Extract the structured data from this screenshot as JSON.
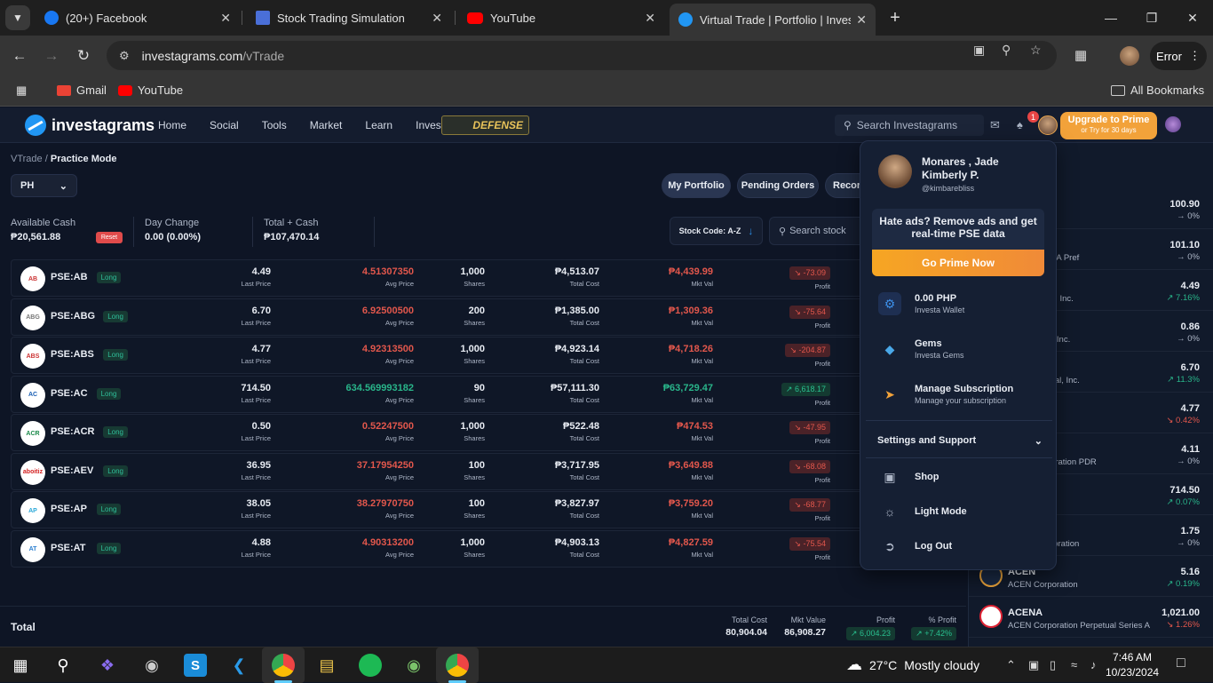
{
  "browser": {
    "tabs": [
      {
        "title": "(20+) Facebook",
        "favicon": "facebook-icon",
        "color": "#1877f2"
      },
      {
        "title": "Stock Trading Simulation",
        "favicon": "chart-icon",
        "color": "#4a6fd8"
      },
      {
        "title": "YouTube",
        "favicon": "youtube-icon",
        "color": "#ff0000"
      },
      {
        "title": "Virtual Trade | Portfolio | Investa",
        "favicon": "investagrams-icon",
        "color": "#2196f3"
      }
    ],
    "url_domain": "investagrams.com",
    "url_path": "/vTrade",
    "error_label": "Error",
    "bookmarks": [
      {
        "label": "Gmail",
        "icon": "gmail-icon"
      },
      {
        "label": "YouTube",
        "icon": "youtube-icon"
      }
    ],
    "all_bookmarks_label": "All Bookmarks"
  },
  "site": {
    "logo_text": "investagrams",
    "nav": [
      "Home",
      "Social",
      "Tools",
      "Market",
      "Learn",
      "Invest"
    ],
    "defense_label": "DEFENSE",
    "search_placeholder": "Search Investagrams",
    "notification_count": "1",
    "upgrade_title": "Upgrade to Prime",
    "upgrade_sub": "or Try for 30 days"
  },
  "portfolio": {
    "breadcrumb_root": "VTrade",
    "breadcrumb_sep": "/",
    "breadcrumb_current": "Practice Mode",
    "country": "PH",
    "tabs": [
      "My Portfolio",
      "Pending Orders",
      "Recor"
    ],
    "available_cash_label": "Available Cash",
    "available_cash": "₱20,561.88",
    "reset_label": "Reset",
    "day_change_label": "Day Change",
    "day_change": "0.00 (0.00%)",
    "total_cash_label": "Total + Cash",
    "total_cash": "₱107,470.14",
    "sort_label": "Stock Code: A-Z",
    "search_stock_placeholder": "Search stock",
    "column_labels": {
      "last_price": "Last Price",
      "avg_price": "Avg Price",
      "shares": "Shares",
      "total_cost": "Total Cost",
      "mkt_val": "Mkt Val",
      "profit": "Profit"
    },
    "position_label": "Long",
    "holdings": [
      {
        "code": "PSE:AB",
        "last": "4.49",
        "avg": "4.51307350",
        "shares": "1,000",
        "cost": "₱4,513.07",
        "mkt": "₱4,439.99",
        "profit": "-73.09",
        "dir": "neg",
        "logo": "AB",
        "logo_color": "#c33"
      },
      {
        "code": "PSE:ABG",
        "last": "6.70",
        "avg": "6.92500500",
        "shares": "200",
        "cost": "₱1,385.00",
        "mkt": "₱1,309.36",
        "profit": "-75.64",
        "dir": "neg",
        "logo": "ABG",
        "logo_color": "#777"
      },
      {
        "code": "PSE:ABS",
        "last": "4.77",
        "avg": "4.92313500",
        "shares": "1,000",
        "cost": "₱4,923.14",
        "mkt": "₱4,718.26",
        "profit": "-204.87",
        "dir": "neg",
        "logo": "ABS",
        "logo_color": "#c33"
      },
      {
        "code": "PSE:AC",
        "last": "714.50",
        "avg": "634.569993182",
        "shares": "90",
        "cost": "₱57,111.30",
        "mkt": "₱63,729.47",
        "profit": "6,618.17",
        "dir": "pos",
        "logo": "AC",
        "logo_color": "#1a5fb4"
      },
      {
        "code": "PSE:ACR",
        "last": "0.50",
        "avg": "0.52247500",
        "shares": "1,000",
        "cost": "₱522.48",
        "mkt": "₱474.53",
        "profit": "-47.95",
        "dir": "neg",
        "logo": "ACR",
        "logo_color": "#1b8a4a"
      },
      {
        "code": "PSE:AEV",
        "last": "36.95",
        "avg": "37.17954250",
        "shares": "100",
        "cost": "₱3,717.95",
        "mkt": "₱3,649.88",
        "profit": "-68.08",
        "dir": "neg",
        "logo": "aboitiz",
        "logo_color": "#d42020"
      },
      {
        "code": "PSE:AP",
        "last": "38.05",
        "avg": "38.27970750",
        "shares": "100",
        "cost": "₱3,827.97",
        "mkt": "₱3,759.20",
        "profit": "-68.77",
        "dir": "neg",
        "logo": "AP",
        "logo_color": "#2aa8d8"
      },
      {
        "code": "PSE:AT",
        "last": "4.88",
        "avg": "4.90313200",
        "shares": "1,000",
        "cost": "₱4,903.13",
        "mkt": "₱4,827.59",
        "profit": "-75.54",
        "dir": "neg",
        "logo": "AT",
        "logo_color": "#2b7fd0"
      }
    ],
    "total_label": "Total",
    "totals": {
      "cost_label": "Total Cost",
      "cost": "80,904.04",
      "mkt_label": "Mkt Value",
      "mkt": "86,908.27",
      "profit_label": "Profit",
      "profit": "6,004.23",
      "pct_label": "% Profit",
      "pct": "+7.42%"
    }
  },
  "market_list": [
    {
      "name": "",
      "desc": "",
      "price": "100.90",
      "change": "→ 0%",
      "dir": "flat"
    },
    {
      "name": "",
      "desc": "s Inc. Series A Pref",
      "price": "101.10",
      "change": "→ 0%",
      "dir": "flat"
    },
    {
      "name": "",
      "desc": "ge Company, Inc.",
      "price": "4.49",
      "change": "↗ 7.16%",
      "dir": "up"
    },
    {
      "name": "",
      "desc": "tal Holdings, Inc.",
      "price": "0.86",
      "change": "→ 0%",
      "dir": "flat"
    },
    {
      "name": "",
      "desc": "p International, Inc.",
      "price": "6.70",
      "change": "↗ 11.3%",
      "dir": "up"
    },
    {
      "name": "",
      "desc": "orporation",
      "price": "4.77",
      "change": "↘ 0.42%",
      "dir": "down"
    },
    {
      "name": "",
      "desc": "ldings Corporation PDR",
      "price": "4.11",
      "change": "→ 0%",
      "dir": "flat"
    },
    {
      "name": "",
      "desc": "tion",
      "price": "714.50",
      "change": "↗ 0.07%",
      "dir": "up"
    },
    {
      "name": "",
      "desc": ") Hotel Corporation",
      "price": "1.75",
      "change": "→ 0%",
      "dir": "flat"
    },
    {
      "name": "ACEN",
      "desc": "ACEN Corporation",
      "price": "5.16",
      "change": "↗ 0.19%",
      "dir": "up"
    },
    {
      "name": "ACENA",
      "desc": "ACEN Corporation Perpetual Series A Pr...",
      "price": "1,021.00",
      "change": "↘ 1.26%",
      "dir": "down"
    }
  ],
  "profile_menu": {
    "name": "Monares , Jade Kimberly P.",
    "username": "@kimbarebliss",
    "ad_text": "Hate ads? Remove ads and get real-time PSE data",
    "go_prime": "Go Prime Now",
    "wallet_title": "0.00 PHP",
    "wallet_sub": "Investa Wallet",
    "gems_title": "Gems",
    "gems_sub": "Investa Gems",
    "sub_title": "Manage Subscription",
    "sub_sub": "Manage your subscription",
    "settings_label": "Settings and Support",
    "shop": "Shop",
    "light_mode": "Light Mode",
    "logout": "Log Out"
  },
  "taskbar": {
    "weather_temp": "27°C",
    "weather_text": "Mostly cloudy",
    "weather_badge": "1",
    "time": "7:46 AM",
    "date": "10/23/2024"
  },
  "colors": {
    "accent": "#2196f3",
    "negative": "#e2574c",
    "positive": "#29b58a",
    "prime_orange": "#f2a23a"
  }
}
